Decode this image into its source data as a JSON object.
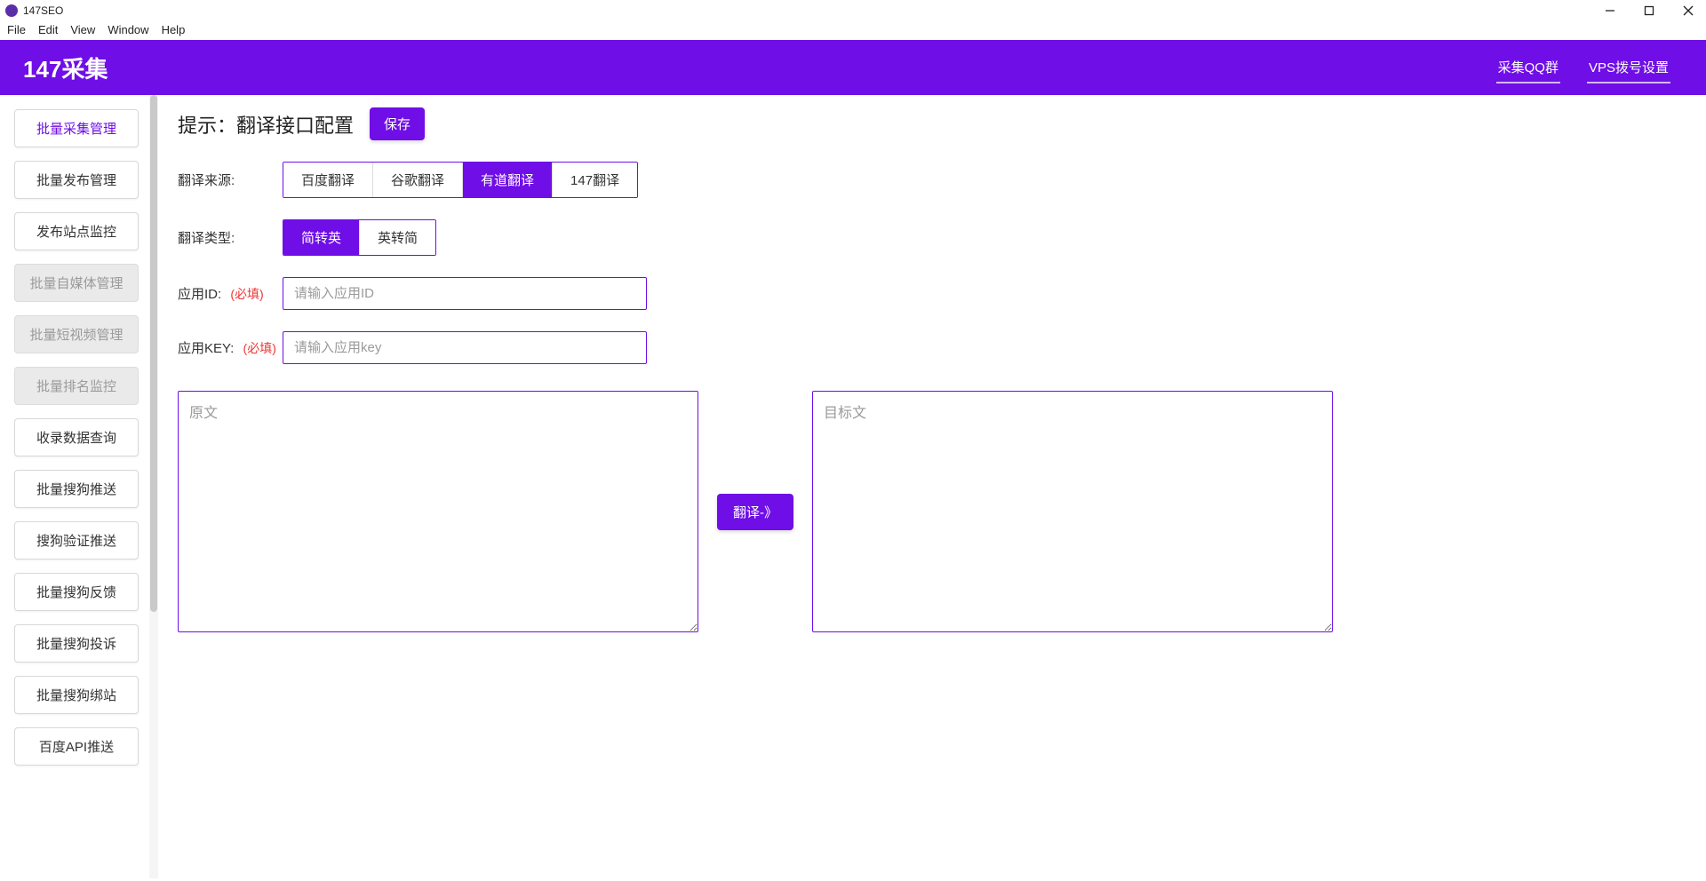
{
  "window": {
    "title": "147SEO"
  },
  "menu": {
    "file": "File",
    "edit": "Edit",
    "view": "View",
    "window": "Window",
    "help": "Help"
  },
  "header": {
    "brand": "147采集",
    "link_qq": "采集QQ群",
    "link_vps": "VPS拨号设置"
  },
  "sidebar": {
    "items": [
      {
        "label": "批量采集管理",
        "state": "active"
      },
      {
        "label": "批量发布管理",
        "state": "normal"
      },
      {
        "label": "发布站点监控",
        "state": "normal"
      },
      {
        "label": "批量自媒体管理",
        "state": "disabled"
      },
      {
        "label": "批量短视频管理",
        "state": "disabled"
      },
      {
        "label": "批量排名监控",
        "state": "disabled"
      },
      {
        "label": "收录数据查询",
        "state": "normal"
      },
      {
        "label": "批量搜狗推送",
        "state": "normal"
      },
      {
        "label": "搜狗验证推送",
        "state": "normal"
      },
      {
        "label": "批量搜狗反馈",
        "state": "normal"
      },
      {
        "label": "批量搜狗投诉",
        "state": "normal"
      },
      {
        "label": "批量搜狗绑站",
        "state": "normal"
      },
      {
        "label": "百度API推送",
        "state": "normal"
      }
    ]
  },
  "page": {
    "head_label": "提示：翻译接口配置",
    "save_btn": "保存",
    "label_source": "翻译来源:",
    "label_type": "翻译类型:",
    "label_appid": "应用ID:",
    "label_appkey": "应用KEY:",
    "required": "(必填)",
    "sources": [
      {
        "label": "百度翻译",
        "on": false
      },
      {
        "label": "谷歌翻译",
        "on": false
      },
      {
        "label": "有道翻译",
        "on": true
      },
      {
        "label": "147翻译",
        "on": false
      }
    ],
    "types": [
      {
        "label": "简转英",
        "on": true
      },
      {
        "label": "英转简",
        "on": false
      }
    ],
    "appid_placeholder": "请输入应用ID",
    "appkey_placeholder": "请输入应用key",
    "src_placeholder": "原文",
    "tgt_placeholder": "目标文",
    "translate_btn": "翻译-》"
  }
}
